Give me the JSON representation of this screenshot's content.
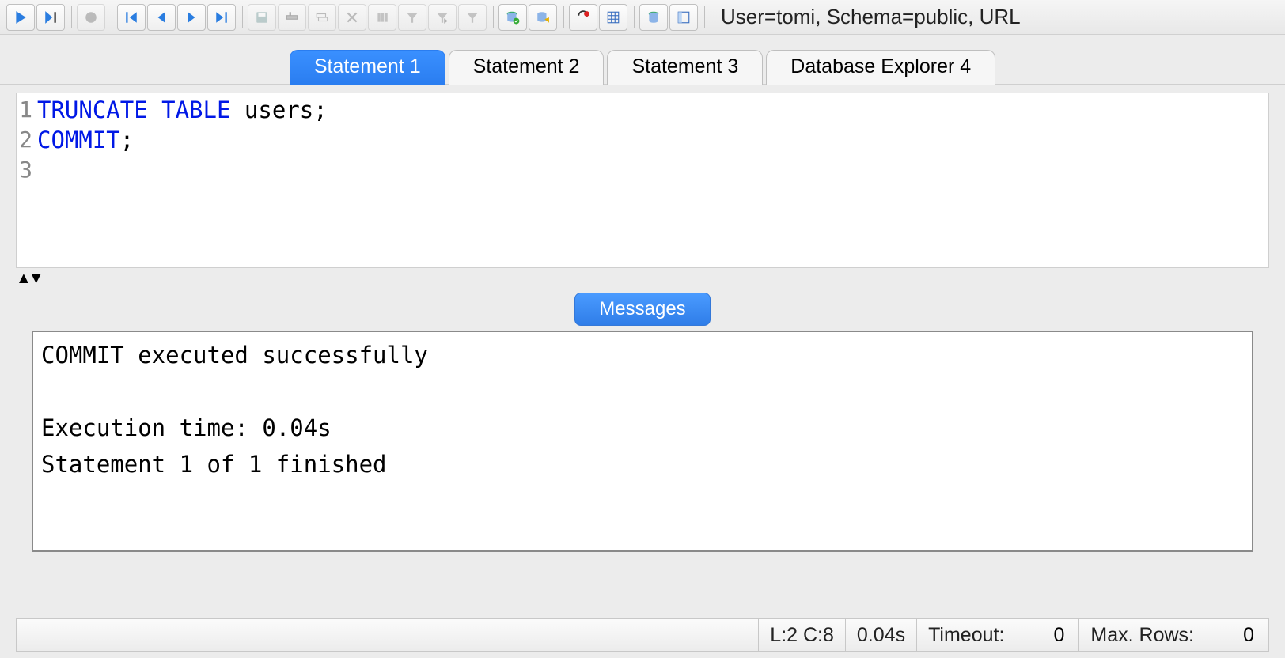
{
  "toolbar": {
    "connection_info": "User=tomi, Schema=public, URL"
  },
  "tabs": [
    {
      "label": "Statement 1",
      "active": true
    },
    {
      "label": "Statement 2",
      "active": false
    },
    {
      "label": "Statement 3",
      "active": false
    },
    {
      "label": "Database Explorer 4",
      "active": false
    }
  ],
  "editor": {
    "line_numbers": [
      "1",
      "2",
      "3"
    ],
    "lines": [
      {
        "kw": "TRUNCATE TABLE",
        "rest": " users;"
      },
      {
        "kw": "COMMIT",
        "rest": ";"
      },
      {
        "kw": "",
        "rest": ""
      }
    ]
  },
  "messages_tab": "Messages",
  "messages": "COMMIT executed successfully\n\nExecution time: 0.04s\nStatement 1 of 1 finished",
  "status": {
    "cursor": "L:2 C:8",
    "time": "0.04s",
    "timeout_label": "Timeout:",
    "timeout_value": "0",
    "maxrows_label": "Max. Rows:",
    "maxrows_value": "0"
  }
}
